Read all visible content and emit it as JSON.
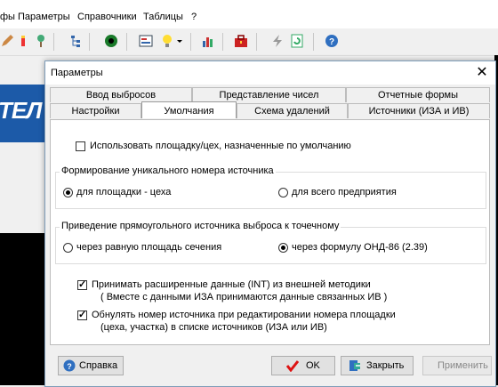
{
  "menu": [
    "фы",
    "Параметры",
    "Справочники",
    "Таблицы",
    "?"
  ],
  "bg_logo_text": "ТЕЛ",
  "dialog": {
    "title": "Параметры",
    "close": "✕",
    "tabs_row1": [
      "Ввод выбросов",
      "Представление чисел",
      "Отчетные формы"
    ],
    "tabs_row2": [
      "Настройки",
      "Умолчания",
      "Схема удалений",
      "Источники (ИЗА и ИВ)"
    ],
    "active_tab": "Умолчания",
    "use_default_site": "Использовать площадку/цех, назначенные по умолчанию",
    "group_numbering": {
      "title": "Формирование уникального номера источника",
      "opt_site": "для площадки - цеха",
      "opt_enterprise": "для всего предприятия"
    },
    "group_rect": {
      "title": "Приведение прямоугольного источника выброса к точечному",
      "opt_area": "через равную площадь сечения",
      "opt_formula": "через формулу  ОНД-86   (2.39)"
    },
    "accept_int": "Принимать расширенные данные (INT) из внешней методики",
    "accept_int_note": "( Вместе с данными ИЗА принимаются данные связанных ИВ )",
    "reset_number": "Обнулять номер источника при редактировании номера площадки",
    "reset_number_note": "(цеха, участка) в списке  источников (ИЗА или ИВ)",
    "buttons": {
      "help": "Справка",
      "ok": "OK",
      "close": "Закрыть",
      "apply": "Применить"
    }
  }
}
